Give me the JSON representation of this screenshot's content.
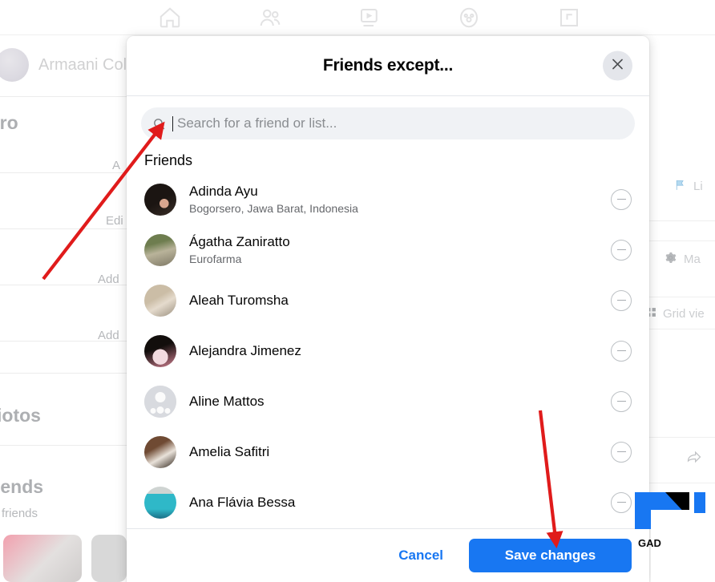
{
  "background": {
    "nav_icons": [
      "home-icon",
      "friends-icon",
      "watch-icon",
      "groups-icon",
      "gaming-icon"
    ],
    "profile_name": "Armaani Col",
    "left_items": [
      {
        "label": "tro",
        "style": "big"
      },
      {
        "label": "A",
        "style": "sm"
      },
      {
        "label": "Edi",
        "style": "sm"
      },
      {
        "label": "Add",
        "style": "sm"
      },
      {
        "label": "Add",
        "style": "sm"
      },
      {
        "label": "iotos",
        "style": "big"
      },
      {
        "label": "iends",
        "style": "big"
      },
      {
        "label": "friends",
        "style": "sm"
      }
    ],
    "right_items": [
      {
        "label": "Li",
        "icon": "flag-icon"
      },
      {
        "label": "Ma",
        "icon": "gear-icon"
      },
      {
        "label": "Grid vie",
        "icon": "grid-icon"
      },
      {
        "label": "",
        "icon": "share-icon"
      }
    ],
    "watermark_text": "GAD"
  },
  "dialog": {
    "title": "Friends except...",
    "close_label": "close-icon",
    "search": {
      "placeholder": "Search for a friend or list...",
      "value": ""
    },
    "section_label": "Friends",
    "friends": [
      {
        "name": "Adinda Ayu",
        "subtitle": "Bogorsero, Jawa Barat, Indonesia",
        "avatar": "a-adinda",
        "action": "remove"
      },
      {
        "name": "Ágatha Zaniratto",
        "subtitle": "Eurofarma",
        "avatar": "a-agatha",
        "action": "remove"
      },
      {
        "name": "Aleah Turomsha",
        "subtitle": "",
        "avatar": "a-aleah",
        "action": "remove"
      },
      {
        "name": "Alejandra Jimenez",
        "subtitle": "",
        "avatar": "a-alejandra",
        "action": "remove"
      },
      {
        "name": "Aline Mattos",
        "subtitle": "",
        "avatar": "a-aline",
        "action": "remove"
      },
      {
        "name": "Amelia Safitri",
        "subtitle": "",
        "avatar": "a-amelia",
        "action": "remove"
      },
      {
        "name": "Ana Flávia Bessa",
        "subtitle": "",
        "avatar": "a-ana",
        "action": "remove"
      }
    ],
    "footer": {
      "cancel_label": "Cancel",
      "save_label": "Save changes"
    }
  },
  "colors": {
    "accent": "#1877f2",
    "annotation": "#e01b1b",
    "text_primary": "#050505",
    "text_secondary": "#65676b",
    "field_bg": "#f0f2f5"
  },
  "annotations": [
    {
      "name": "arrow-to-search-field",
      "color": "#e01b1b"
    },
    {
      "name": "arrow-to-save-button",
      "color": "#e01b1b"
    }
  ]
}
